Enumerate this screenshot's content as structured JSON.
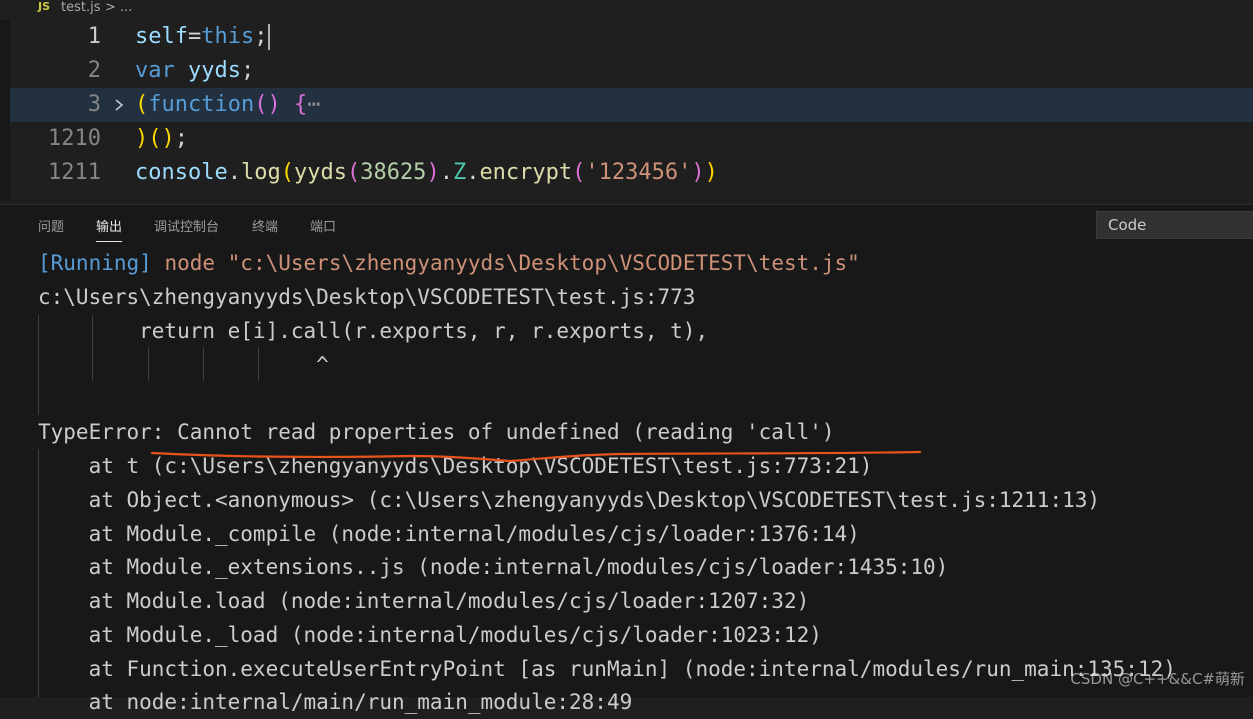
{
  "breadcrumb": {
    "file_icon": "JS",
    "file": "test.js",
    "separator": ">",
    "more": "..."
  },
  "editor": {
    "lines": [
      {
        "number": "1"
      },
      {
        "number": "2"
      },
      {
        "number": "3"
      },
      {
        "number": "1210"
      },
      {
        "number": "1211"
      }
    ],
    "fold_icon": "chevron-right-icon"
  },
  "panel": {
    "tabs": [
      "问题",
      "输出",
      "调试控制台",
      "终端",
      "端口"
    ],
    "active_tab": "输出",
    "channel_select": "Code"
  },
  "output": {
    "running_tag": "[Running]",
    "running_cmd": "node \"c:\\Users\\zhengyanyyds\\Desktop\\VSCODETEST\\test.js\"",
    "lines": [
      "c:\\Users\\zhengyanyyds\\Desktop\\VSCODETEST\\test.js:773",
      "        return e[i].call(r.exports, r, r.exports, t),",
      "                      ^",
      "",
      "TypeError: Cannot read properties of undefined (reading 'call')",
      "    at t (c:\\Users\\zhengyanyyds\\Desktop\\VSCODETEST\\test.js:773:21)",
      "    at Object.<anonymous> (c:\\Users\\zhengyanyyds\\Desktop\\VSCODETEST\\test.js:1211:13)",
      "    at Module._compile (node:internal/modules/cjs/loader:1376:14)",
      "    at Module._extensions..js (node:internal/modules/cjs/loader:1435:10)",
      "    at Module.load (node:internal/modules/cjs/loader:1207:32)",
      "    at Module._load (node:internal/modules/cjs/loader:1023:12)",
      "    at Function.executeUserEntryPoint [as runMain] (node:internal/modules/run_main:135:12)",
      "    at node:internal/main/run_main_module:28:49"
    ]
  },
  "annotation_color": "#e8531a",
  "watermark": "CSDN @C++&&C#萌新"
}
